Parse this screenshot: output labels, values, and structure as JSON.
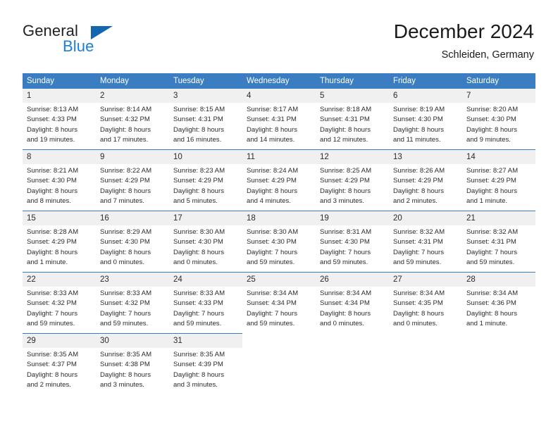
{
  "brand": {
    "name_part1": "General",
    "name_part2": "Blue",
    "logo_icon": "triangle-flag-icon",
    "accent_color": "#1566b0"
  },
  "header": {
    "title": "December 2024",
    "subtitle": "Schleiden, Germany"
  },
  "calendar": {
    "header_color": "#3a7ec1",
    "weekday_headers": [
      "Sunday",
      "Monday",
      "Tuesday",
      "Wednesday",
      "Thursday",
      "Friday",
      "Saturday"
    ],
    "weeks": [
      [
        {
          "day": "1",
          "sunrise": "Sunrise: 8:13 AM",
          "sunset": "Sunset: 4:33 PM",
          "daylight_line1": "Daylight: 8 hours",
          "daylight_line2": "and 19 minutes."
        },
        {
          "day": "2",
          "sunrise": "Sunrise: 8:14 AM",
          "sunset": "Sunset: 4:32 PM",
          "daylight_line1": "Daylight: 8 hours",
          "daylight_line2": "and 17 minutes."
        },
        {
          "day": "3",
          "sunrise": "Sunrise: 8:15 AM",
          "sunset": "Sunset: 4:31 PM",
          "daylight_line1": "Daylight: 8 hours",
          "daylight_line2": "and 16 minutes."
        },
        {
          "day": "4",
          "sunrise": "Sunrise: 8:17 AM",
          "sunset": "Sunset: 4:31 PM",
          "daylight_line1": "Daylight: 8 hours",
          "daylight_line2": "and 14 minutes."
        },
        {
          "day": "5",
          "sunrise": "Sunrise: 8:18 AM",
          "sunset": "Sunset: 4:31 PM",
          "daylight_line1": "Daylight: 8 hours",
          "daylight_line2": "and 12 minutes."
        },
        {
          "day": "6",
          "sunrise": "Sunrise: 8:19 AM",
          "sunset": "Sunset: 4:30 PM",
          "daylight_line1": "Daylight: 8 hours",
          "daylight_line2": "and 11 minutes."
        },
        {
          "day": "7",
          "sunrise": "Sunrise: 8:20 AM",
          "sunset": "Sunset: 4:30 PM",
          "daylight_line1": "Daylight: 8 hours",
          "daylight_line2": "and 9 minutes."
        }
      ],
      [
        {
          "day": "8",
          "sunrise": "Sunrise: 8:21 AM",
          "sunset": "Sunset: 4:30 PM",
          "daylight_line1": "Daylight: 8 hours",
          "daylight_line2": "and 8 minutes."
        },
        {
          "day": "9",
          "sunrise": "Sunrise: 8:22 AM",
          "sunset": "Sunset: 4:29 PM",
          "daylight_line1": "Daylight: 8 hours",
          "daylight_line2": "and 7 minutes."
        },
        {
          "day": "10",
          "sunrise": "Sunrise: 8:23 AM",
          "sunset": "Sunset: 4:29 PM",
          "daylight_line1": "Daylight: 8 hours",
          "daylight_line2": "and 5 minutes."
        },
        {
          "day": "11",
          "sunrise": "Sunrise: 8:24 AM",
          "sunset": "Sunset: 4:29 PM",
          "daylight_line1": "Daylight: 8 hours",
          "daylight_line2": "and 4 minutes."
        },
        {
          "day": "12",
          "sunrise": "Sunrise: 8:25 AM",
          "sunset": "Sunset: 4:29 PM",
          "daylight_line1": "Daylight: 8 hours",
          "daylight_line2": "and 3 minutes."
        },
        {
          "day": "13",
          "sunrise": "Sunrise: 8:26 AM",
          "sunset": "Sunset: 4:29 PM",
          "daylight_line1": "Daylight: 8 hours",
          "daylight_line2": "and 2 minutes."
        },
        {
          "day": "14",
          "sunrise": "Sunrise: 8:27 AM",
          "sunset": "Sunset: 4:29 PM",
          "daylight_line1": "Daylight: 8 hours",
          "daylight_line2": "and 1 minute."
        }
      ],
      [
        {
          "day": "15",
          "sunrise": "Sunrise: 8:28 AM",
          "sunset": "Sunset: 4:29 PM",
          "daylight_line1": "Daylight: 8 hours",
          "daylight_line2": "and 1 minute."
        },
        {
          "day": "16",
          "sunrise": "Sunrise: 8:29 AM",
          "sunset": "Sunset: 4:30 PM",
          "daylight_line1": "Daylight: 8 hours",
          "daylight_line2": "and 0 minutes."
        },
        {
          "day": "17",
          "sunrise": "Sunrise: 8:30 AM",
          "sunset": "Sunset: 4:30 PM",
          "daylight_line1": "Daylight: 8 hours",
          "daylight_line2": "and 0 minutes."
        },
        {
          "day": "18",
          "sunrise": "Sunrise: 8:30 AM",
          "sunset": "Sunset: 4:30 PM",
          "daylight_line1": "Daylight: 7 hours",
          "daylight_line2": "and 59 minutes."
        },
        {
          "day": "19",
          "sunrise": "Sunrise: 8:31 AM",
          "sunset": "Sunset: 4:30 PM",
          "daylight_line1": "Daylight: 7 hours",
          "daylight_line2": "and 59 minutes."
        },
        {
          "day": "20",
          "sunrise": "Sunrise: 8:32 AM",
          "sunset": "Sunset: 4:31 PM",
          "daylight_line1": "Daylight: 7 hours",
          "daylight_line2": "and 59 minutes."
        },
        {
          "day": "21",
          "sunrise": "Sunrise: 8:32 AM",
          "sunset": "Sunset: 4:31 PM",
          "daylight_line1": "Daylight: 7 hours",
          "daylight_line2": "and 59 minutes."
        }
      ],
      [
        {
          "day": "22",
          "sunrise": "Sunrise: 8:33 AM",
          "sunset": "Sunset: 4:32 PM",
          "daylight_line1": "Daylight: 7 hours",
          "daylight_line2": "and 59 minutes."
        },
        {
          "day": "23",
          "sunrise": "Sunrise: 8:33 AM",
          "sunset": "Sunset: 4:32 PM",
          "daylight_line1": "Daylight: 7 hours",
          "daylight_line2": "and 59 minutes."
        },
        {
          "day": "24",
          "sunrise": "Sunrise: 8:33 AM",
          "sunset": "Sunset: 4:33 PM",
          "daylight_line1": "Daylight: 7 hours",
          "daylight_line2": "and 59 minutes."
        },
        {
          "day": "25",
          "sunrise": "Sunrise: 8:34 AM",
          "sunset": "Sunset: 4:34 PM",
          "daylight_line1": "Daylight: 7 hours",
          "daylight_line2": "and 59 minutes."
        },
        {
          "day": "26",
          "sunrise": "Sunrise: 8:34 AM",
          "sunset": "Sunset: 4:34 PM",
          "daylight_line1": "Daylight: 8 hours",
          "daylight_line2": "and 0 minutes."
        },
        {
          "day": "27",
          "sunrise": "Sunrise: 8:34 AM",
          "sunset": "Sunset: 4:35 PM",
          "daylight_line1": "Daylight: 8 hours",
          "daylight_line2": "and 0 minutes."
        },
        {
          "day": "28",
          "sunrise": "Sunrise: 8:34 AM",
          "sunset": "Sunset: 4:36 PM",
          "daylight_line1": "Daylight: 8 hours",
          "daylight_line2": "and 1 minute."
        }
      ],
      [
        {
          "day": "29",
          "sunrise": "Sunrise: 8:35 AM",
          "sunset": "Sunset: 4:37 PM",
          "daylight_line1": "Daylight: 8 hours",
          "daylight_line2": "and 2 minutes."
        },
        {
          "day": "30",
          "sunrise": "Sunrise: 8:35 AM",
          "sunset": "Sunset: 4:38 PM",
          "daylight_line1": "Daylight: 8 hours",
          "daylight_line2": "and 3 minutes."
        },
        {
          "day": "31",
          "sunrise": "Sunrise: 8:35 AM",
          "sunset": "Sunset: 4:39 PM",
          "daylight_line1": "Daylight: 8 hours",
          "daylight_line2": "and 3 minutes."
        },
        {
          "day": "",
          "sunrise": "",
          "sunset": "",
          "daylight_line1": "",
          "daylight_line2": ""
        },
        {
          "day": "",
          "sunrise": "",
          "sunset": "",
          "daylight_line1": "",
          "daylight_line2": ""
        },
        {
          "day": "",
          "sunrise": "",
          "sunset": "",
          "daylight_line1": "",
          "daylight_line2": ""
        },
        {
          "day": "",
          "sunrise": "",
          "sunset": "",
          "daylight_line1": "",
          "daylight_line2": ""
        }
      ]
    ]
  }
}
